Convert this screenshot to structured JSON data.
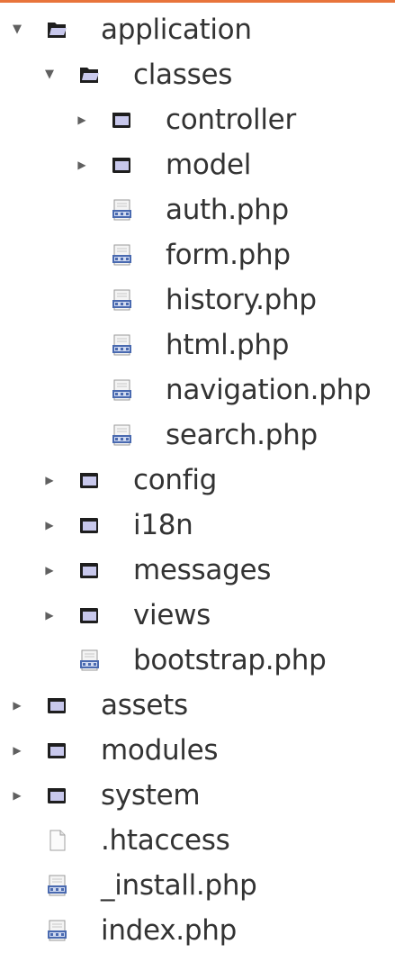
{
  "colors": {
    "accent_top_border": "#e8743b",
    "folder_fill": "#c8c8ec",
    "folder_outline": "#1e1e1e",
    "php_badge": "#4a6ab0",
    "text": "#333333"
  },
  "tree": [
    {
      "label": "application",
      "type": "folder",
      "expanded": true,
      "depth": 0,
      "icon": "folder-open-icon"
    },
    {
      "label": "classes",
      "type": "folder",
      "expanded": true,
      "depth": 1,
      "icon": "folder-open-icon"
    },
    {
      "label": "controller",
      "type": "folder",
      "expanded": false,
      "depth": 2,
      "icon": "folder-icon"
    },
    {
      "label": "model",
      "type": "folder",
      "expanded": false,
      "depth": 2,
      "icon": "folder-icon"
    },
    {
      "label": "auth.php",
      "type": "php",
      "depth": 2,
      "icon": "php-file-icon"
    },
    {
      "label": "form.php",
      "type": "php",
      "depth": 2,
      "icon": "php-file-icon"
    },
    {
      "label": "history.php",
      "type": "php",
      "depth": 2,
      "icon": "php-file-icon"
    },
    {
      "label": "html.php",
      "type": "php",
      "depth": 2,
      "icon": "php-file-icon"
    },
    {
      "label": "navigation.php",
      "type": "php",
      "depth": 2,
      "icon": "php-file-icon"
    },
    {
      "label": "search.php",
      "type": "php",
      "depth": 2,
      "icon": "php-file-icon"
    },
    {
      "label": "config",
      "type": "folder",
      "expanded": false,
      "depth": 1,
      "icon": "folder-icon"
    },
    {
      "label": "i18n",
      "type": "folder",
      "expanded": false,
      "depth": 1,
      "icon": "folder-icon"
    },
    {
      "label": "messages",
      "type": "folder",
      "expanded": false,
      "depth": 1,
      "icon": "folder-icon"
    },
    {
      "label": "views",
      "type": "folder",
      "expanded": false,
      "depth": 1,
      "icon": "folder-icon"
    },
    {
      "label": "bootstrap.php",
      "type": "php",
      "depth": 1,
      "icon": "php-file-icon"
    },
    {
      "label": "assets",
      "type": "folder",
      "expanded": false,
      "depth": 0,
      "icon": "folder-icon"
    },
    {
      "label": "modules",
      "type": "folder",
      "expanded": false,
      "depth": 0,
      "icon": "folder-icon"
    },
    {
      "label": "system",
      "type": "folder",
      "expanded": false,
      "depth": 0,
      "icon": "folder-icon"
    },
    {
      "label": ".htaccess",
      "type": "file",
      "depth": 0,
      "icon": "text-file-icon"
    },
    {
      "label": "_install.php",
      "type": "php",
      "depth": 0,
      "icon": "php-file-icon"
    },
    {
      "label": "index.php",
      "type": "php",
      "depth": 0,
      "icon": "php-file-icon"
    }
  ]
}
